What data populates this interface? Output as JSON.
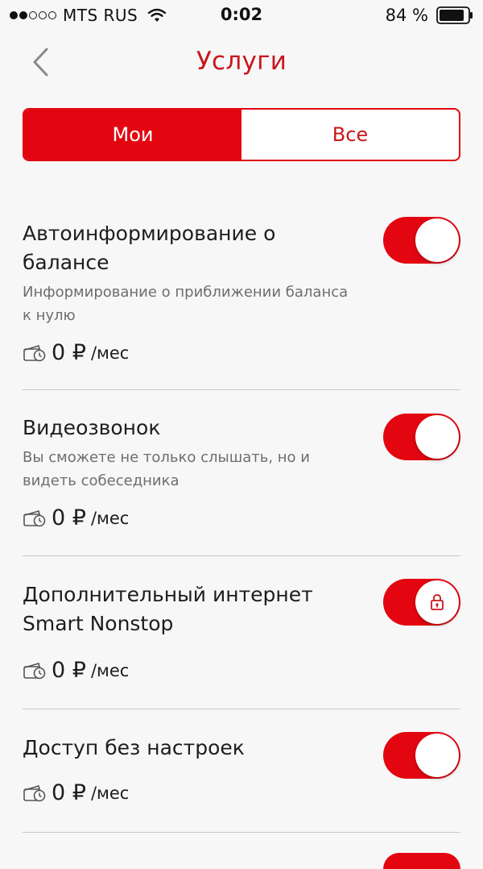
{
  "status_bar": {
    "carrier": "MTS RUS",
    "time": "0:02",
    "battery": "84 %"
  },
  "header": {
    "title": "Услуги"
  },
  "tabs": [
    {
      "label": "Мои",
      "active": true
    },
    {
      "label": "Все",
      "active": false
    }
  ],
  "services": [
    {
      "title": "Автоинформирование о балансе",
      "description": "Информирование о приближении баланса к нулю",
      "price": "0 ₽",
      "unit": "/мес",
      "enabled": true,
      "locked": false
    },
    {
      "title": "Видеозвонок",
      "description": "Вы сможете не только слышать, но и видеть собеседника",
      "price": "0 ₽",
      "unit": "/мес",
      "enabled": true,
      "locked": false
    },
    {
      "title": "Дополнительный интернет Smart Nonstop",
      "description": "",
      "price": "0 ₽",
      "unit": "/мес",
      "enabled": true,
      "locked": true
    },
    {
      "title": "Доступ без настроек",
      "description": "",
      "price": "0 ₽",
      "unit": "/мес",
      "enabled": true,
      "locked": false
    }
  ],
  "colors": {
    "accent": "#e30611",
    "title_red": "#c8171d",
    "background": "#f7f7f7"
  }
}
